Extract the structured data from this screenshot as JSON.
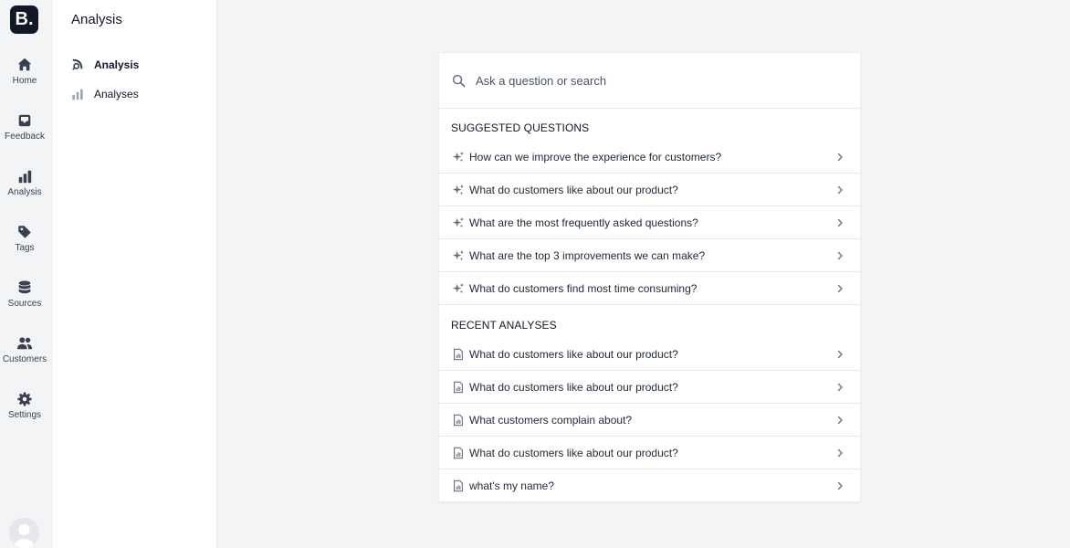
{
  "brand": {
    "logo_text": "B."
  },
  "rail": {
    "items": [
      {
        "label": "Home",
        "icon": "home-icon"
      },
      {
        "label": "Feedback",
        "icon": "inbox-icon"
      },
      {
        "label": "Analysis",
        "icon": "bar-chart-icon"
      },
      {
        "label": "Tags",
        "icon": "tag-icon"
      },
      {
        "label": "Sources",
        "icon": "database-icon"
      },
      {
        "label": "Customers",
        "icon": "users-icon"
      },
      {
        "label": "Settings",
        "icon": "gear-icon"
      }
    ]
  },
  "sidebar": {
    "title": "Analysis",
    "items": [
      {
        "label": "Analysis",
        "icon": "analysis-search-icon",
        "active": true
      },
      {
        "label": "Analyses",
        "icon": "bar-chart-icon",
        "active": false
      }
    ]
  },
  "search": {
    "placeholder": "Ask a question or search"
  },
  "suggested": {
    "heading": "SUGGESTED QUESTIONS",
    "items": [
      "How can we improve the experience for customers?",
      "What do customers like about our product?",
      "What are the most frequently asked questions?",
      "What are the top 3 improvements we can make?",
      "What do customers find most time consuming?"
    ]
  },
  "recent": {
    "heading": "RECENT ANALYSES",
    "items": [
      "What do customers like about our product?",
      "What do customers like about our product?",
      "What customers complain about?",
      "What do customers like about our product?",
      "what's my name?"
    ]
  },
  "colors": {
    "rail_icon": "#374151",
    "logo_bg": "#111827",
    "sparkle_icon": "#6b7280",
    "doc_icon": "#6b7280"
  }
}
